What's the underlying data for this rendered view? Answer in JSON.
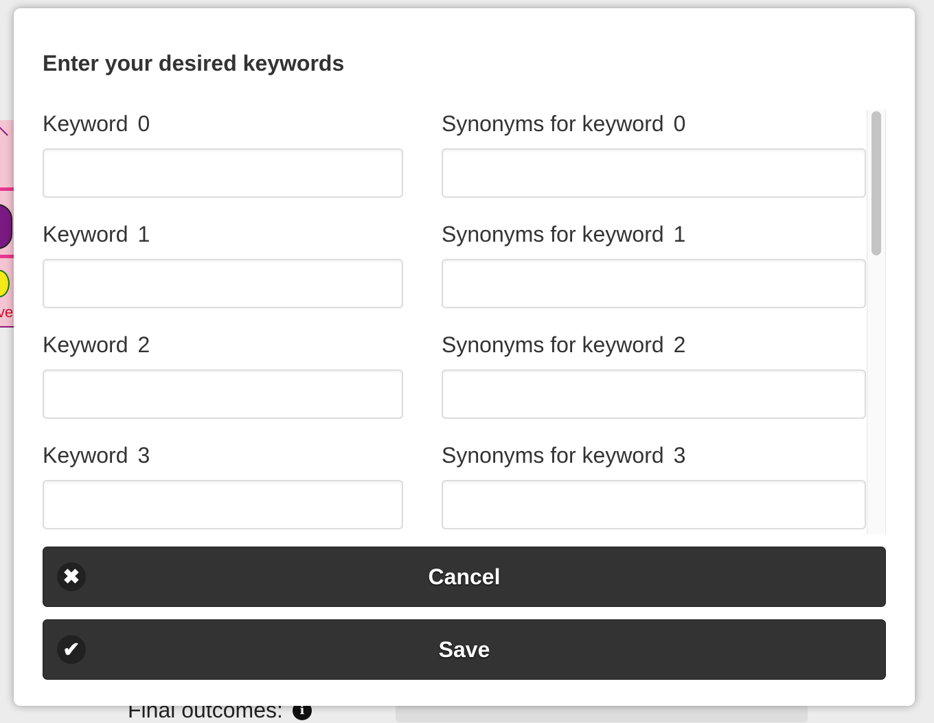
{
  "dialog": {
    "title": "Enter your desired keywords",
    "rows": [
      {
        "keyword_label": "Keyword",
        "index": "0",
        "synonyms_label": "Synonyms for keyword",
        "keyword_value": "",
        "synonyms_value": ""
      },
      {
        "keyword_label": "Keyword",
        "index": "1",
        "synonyms_label": "Synonyms for keyword",
        "keyword_value": "",
        "synonyms_value": ""
      },
      {
        "keyword_label": "Keyword",
        "index": "2",
        "synonyms_label": "Synonyms for keyword",
        "keyword_value": "",
        "synonyms_value": ""
      },
      {
        "keyword_label": "Keyword",
        "index": "3",
        "synonyms_label": "Synonyms for keyword",
        "keyword_value": "",
        "synonyms_value": ""
      }
    ],
    "cancel_label": "Cancel",
    "save_label": "Save",
    "cancel_icon": "close-icon",
    "save_icon": "checkmark-icon"
  },
  "background": {
    "footer_label": "Final outcomes:",
    "info_icon": "info-icon",
    "fragment_text": "ve"
  },
  "colors": {
    "button_bg": "#333333",
    "button_text": "#ffffff",
    "title_text": "#333333"
  }
}
